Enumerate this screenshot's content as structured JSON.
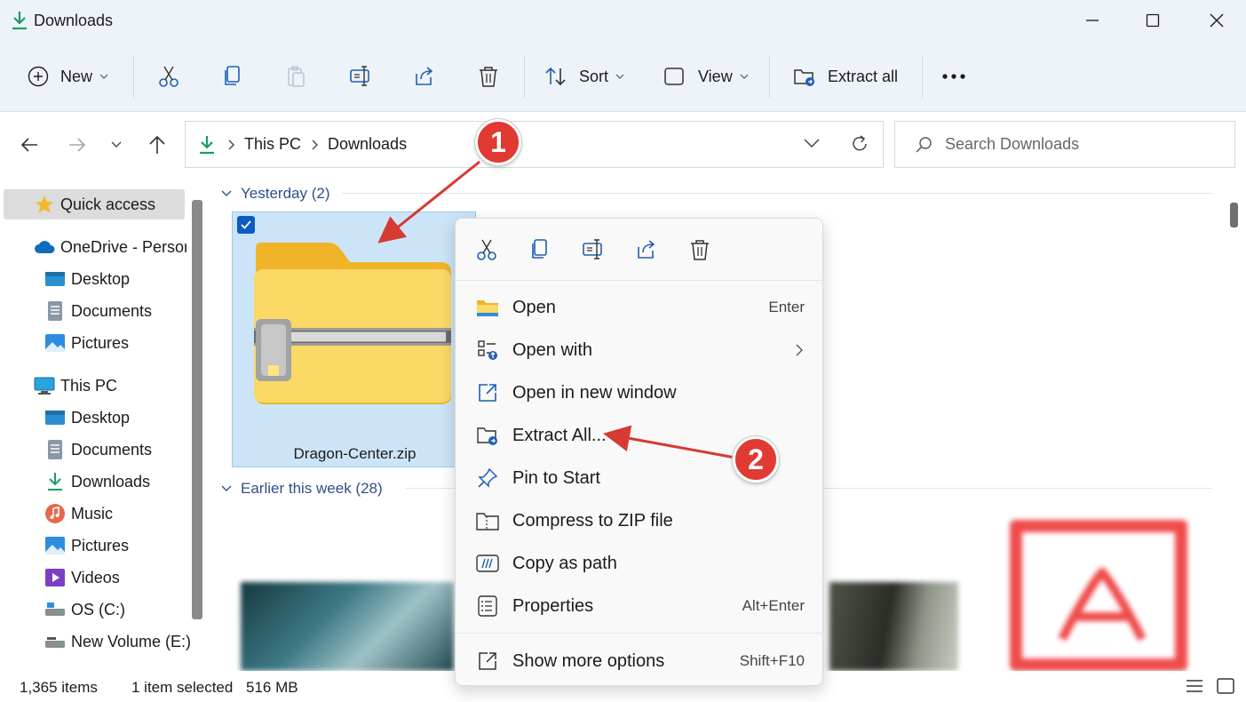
{
  "window": {
    "title": "Downloads",
    "controls": [
      "minimize",
      "maximize",
      "close"
    ]
  },
  "toolbar": {
    "new_label": "New",
    "sort_label": "Sort",
    "view_label": "View",
    "extract_all_label": "Extract all",
    "more_label": "•••",
    "icons": [
      "cut-icon",
      "copy-icon",
      "paste-icon",
      "rename-icon",
      "share-icon",
      "delete-icon"
    ]
  },
  "address": {
    "crumbs": [
      "This PC",
      "Downloads"
    ],
    "search_placeholder": "Search Downloads"
  },
  "sidebar": {
    "items": [
      {
        "label": "Quick access",
        "icon": "star-icon"
      },
      {
        "label": "OneDrive - Persor",
        "icon": "cloud-icon"
      },
      {
        "label": "Desktop",
        "icon": "desktop-folder-icon"
      },
      {
        "label": "Documents",
        "icon": "documents-icon"
      },
      {
        "label": "Pictures",
        "icon": "pictures-icon"
      },
      {
        "label": "This PC",
        "icon": "monitor-icon"
      },
      {
        "label": "Desktop",
        "icon": "desktop-folder-icon"
      },
      {
        "label": "Documents",
        "icon": "documents-icon"
      },
      {
        "label": "Downloads",
        "icon": "download-icon"
      },
      {
        "label": "Music",
        "icon": "music-icon"
      },
      {
        "label": "Pictures",
        "icon": "pictures-icon"
      },
      {
        "label": "Videos",
        "icon": "videos-icon"
      },
      {
        "label": "OS (C:)",
        "icon": "drive-icon"
      },
      {
        "label": "New Volume (E:)",
        "icon": "drive-icon"
      }
    ]
  },
  "content": {
    "groups": [
      {
        "label": "Yesterday (2)"
      },
      {
        "label": "Earlier this week (28)"
      }
    ],
    "selected_file": "Dragon-Center.zip"
  },
  "context_menu": {
    "quick_actions": [
      "cut-icon",
      "copy-icon",
      "rename-icon",
      "share-icon",
      "delete-icon"
    ],
    "items": [
      {
        "label": "Open",
        "shortcut": "Enter"
      },
      {
        "label": "Open with",
        "shortcut": ""
      },
      {
        "label": "Open in new window",
        "shortcut": ""
      },
      {
        "label": "Extract All...",
        "shortcut": ""
      },
      {
        "label": "Pin to Start",
        "shortcut": ""
      },
      {
        "label": "Compress to ZIP file",
        "shortcut": ""
      },
      {
        "label": "Copy as path",
        "shortcut": ""
      },
      {
        "label": "Properties",
        "shortcut": "Alt+Enter"
      },
      {
        "label": "Show more options",
        "shortcut": "Shift+F10"
      }
    ]
  },
  "callouts": [
    "1",
    "2"
  ],
  "status": {
    "item_count": "1,365 items",
    "selection": "1 item selected",
    "size": "516 MB"
  },
  "colors": {
    "accent": "#0b5cc4",
    "callout": "#e03a33",
    "selection_bg": "#cce4f7",
    "chrome_bg": "#eef3f9"
  }
}
